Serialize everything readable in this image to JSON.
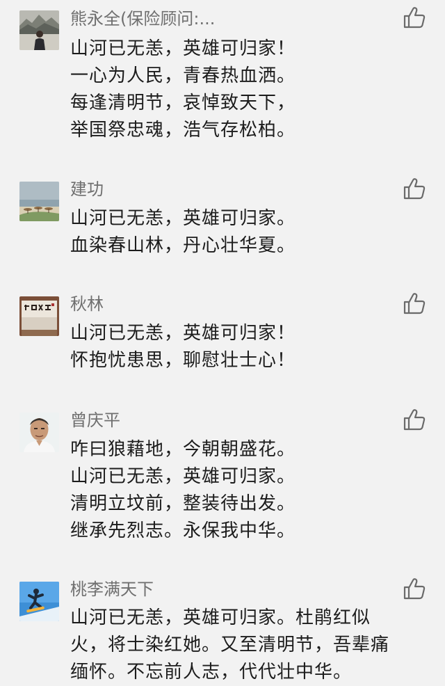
{
  "comments": [
    {
      "name": "熊永全(保险顾问:...",
      "avatar_icon": "landscape-painting-avatar",
      "like_icon": "thumbs-up-icon",
      "lines": [
        "山河已无恙，英雄可归家！",
        "一心为人民，青春热血洒。",
        "每逢清明节，哀悼致天下，",
        "举国祭忠魂，浩气存松柏。"
      ]
    },
    {
      "name": "建功",
      "avatar_icon": "beach-photo-avatar",
      "like_icon": "thumbs-up-icon",
      "lines": [
        "山河已无恙，英雄可归家。",
        "血染春山林，丹心壮华夏。"
      ]
    },
    {
      "name": "秋林",
      "avatar_icon": "calligraphy-avatar",
      "like_icon": "thumbs-up-icon",
      "lines": [
        "山河已无恙，英雄可归家！",
        "怀抱忧患思，聊慰壮士心！"
      ]
    },
    {
      "name": "曾庆平",
      "avatar_icon": "portrait-avatar",
      "like_icon": "thumbs-up-icon",
      "lines": [
        "咋曰狼藉地，今朝朝盛花。",
        "山河已无恙，英雄可归家。",
        "清明立坟前，整装待出发。",
        "继承先烈志。永保我中华。"
      ]
    },
    {
      "name": "桃李满天下",
      "avatar_icon": "snowboarder-avatar",
      "like_icon": "thumbs-up-icon",
      "lines": [
        "山河已无恙，英雄可归家。杜鹃红似",
        "火，将士染红她。又至清明节，吾辈痛",
        "缅怀。不忘前人志，代代壮中华。"
      ]
    }
  ]
}
